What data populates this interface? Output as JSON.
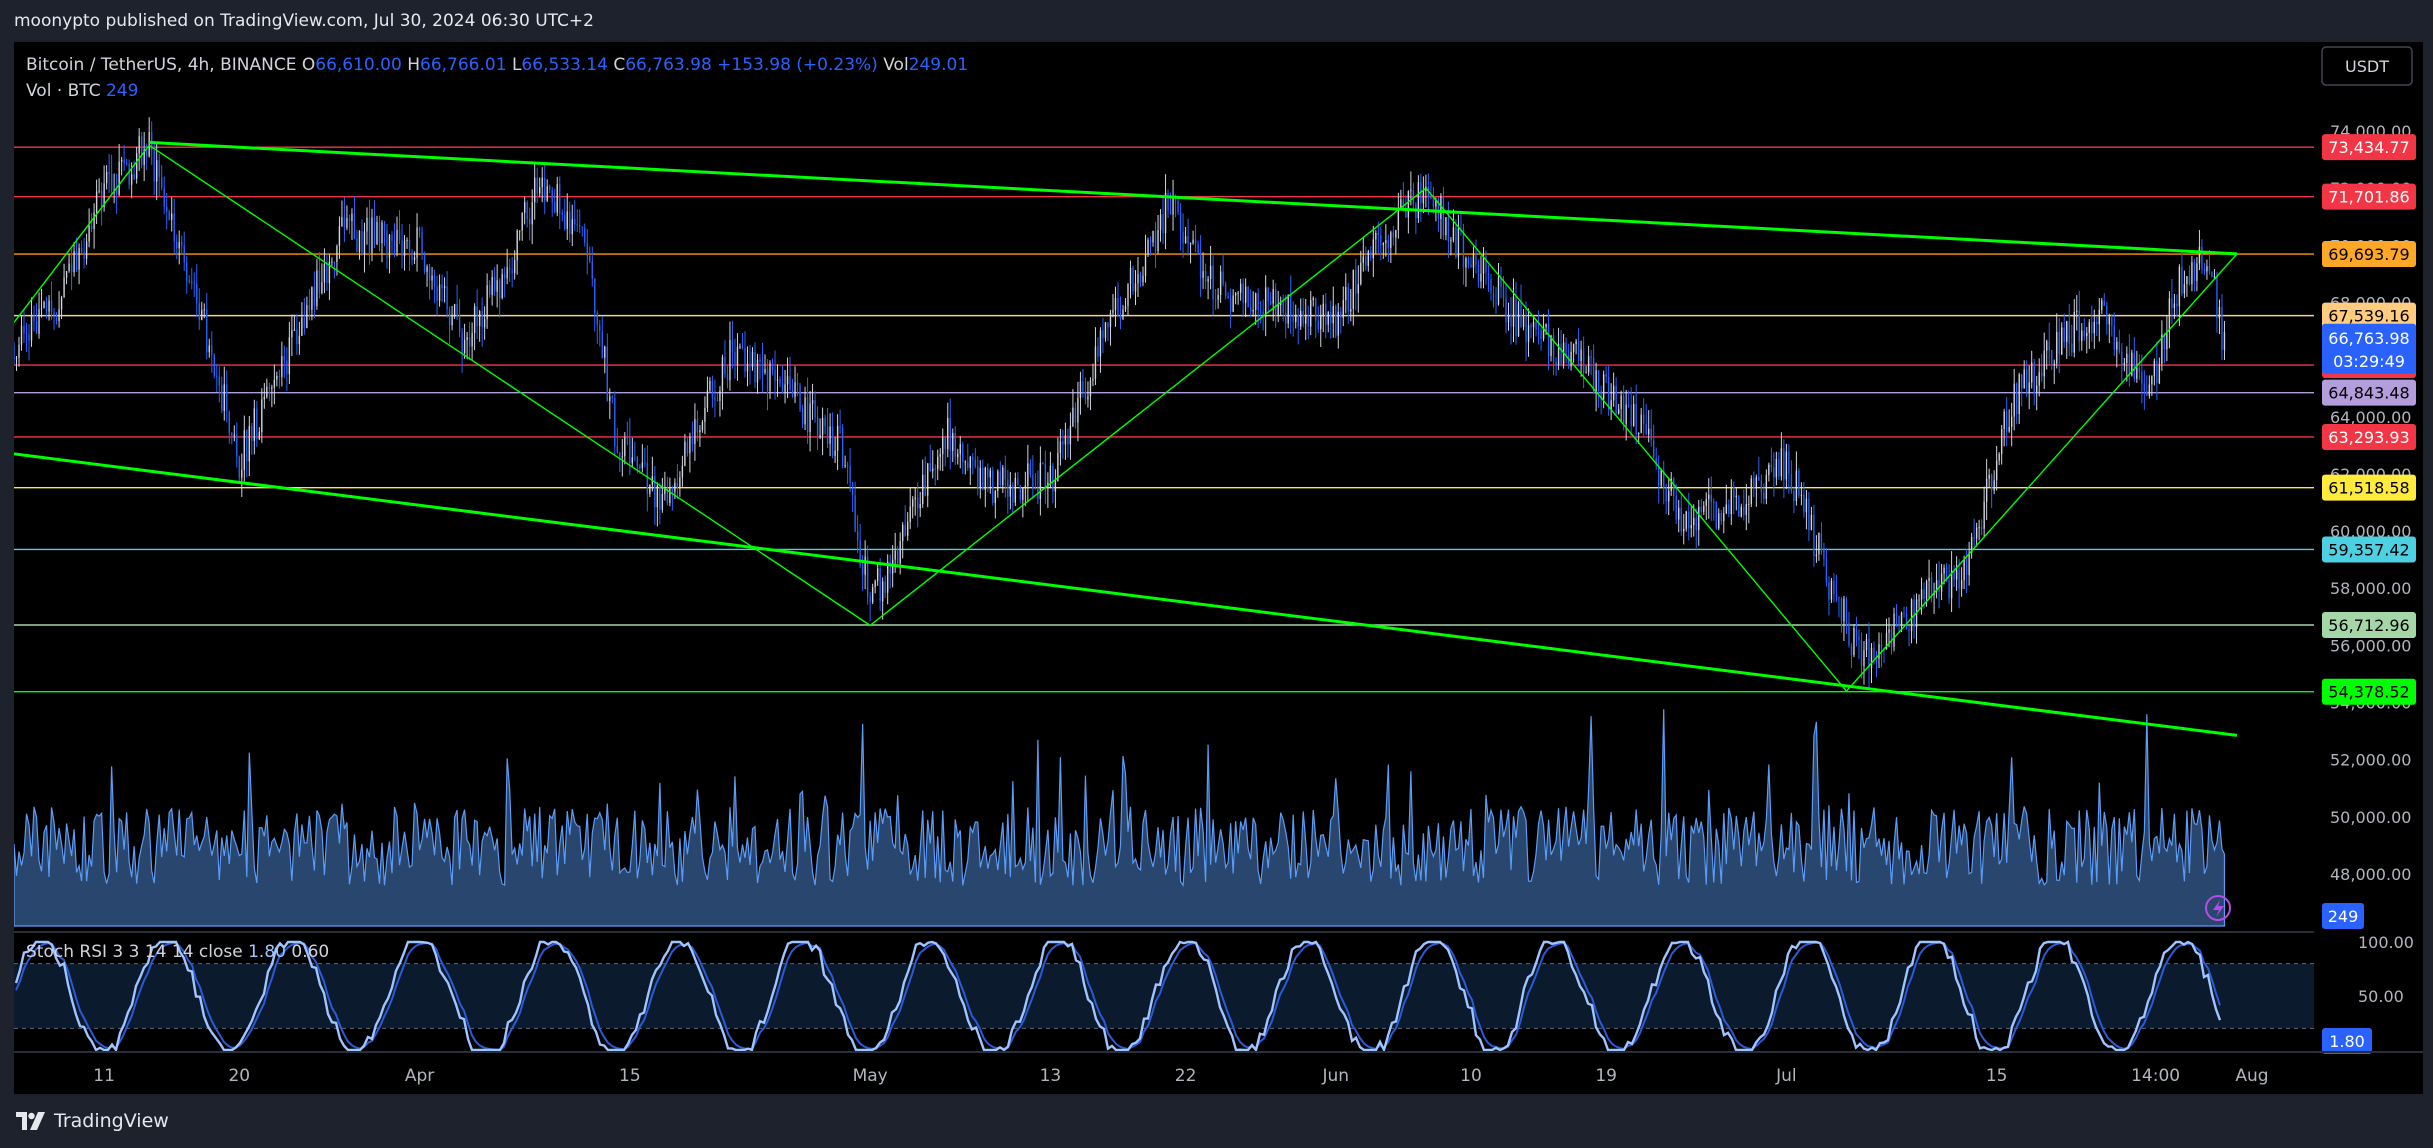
{
  "publish_note": "moonypto published on TradingView.com, Jul 30, 2024 06:30 UTC+2",
  "brand": "TradingView",
  "legend": {
    "symbol": "Bitcoin / TetherUS, 4h, BINANCE",
    "o_label": "O",
    "o_value": "66,610.00",
    "h_label": "H",
    "h_value": "66,766.01",
    "l_label": "L",
    "l_value": "66,533.14",
    "c_label": "C",
    "c_value": "66,763.98",
    "change": "+153.98 (+0.23%)",
    "vol_label": "Vol",
    "vol_value": "249.01",
    "vol_row_label": "Vol · BTC",
    "vol_row_value": "249",
    "stoch_label": "Stoch RSI 3 3 14 14 close",
    "stoch_k": "1.80",
    "stoch_d": "0.60"
  },
  "currency_button": "USDT",
  "colors": {
    "up": "#d1d4dc",
    "down": "#2962ff",
    "trend_green": "#00ff00",
    "volume": "#5b9cf6",
    "stoch_k": "#9fc5ff",
    "stoch_d": "#2a5bd7"
  },
  "chart_data": {
    "type": "candlestick",
    "symbol": "Bitcoin / TetherUS",
    "interval": "4h",
    "exchange": "BINANCE",
    "y_axis": {
      "range": [
        46500,
        75500
      ],
      "ticks": [
        {
          "v": 74000,
          "t": "74,000.00"
        },
        {
          "v": 72000,
          "t": "72,000.00"
        },
        {
          "v": 70000,
          "t": "70,000.00"
        },
        {
          "v": 68000,
          "t": "68,000.00"
        },
        {
          "v": 66000,
          "t": "66,000.00"
        },
        {
          "v": 64000,
          "t": "64,000.00"
        },
        {
          "v": 62000,
          "t": "62,000.00"
        },
        {
          "v": 60000,
          "t": "60,000.00"
        },
        {
          "v": 58000,
          "t": "58,000.00"
        },
        {
          "v": 56000,
          "t": "56,000.00"
        },
        {
          "v": 54000,
          "t": "54,000.00"
        },
        {
          "v": 52000,
          "t": "52,000.00"
        },
        {
          "v": 50000,
          "t": "50,000.00"
        },
        {
          "v": 48000,
          "t": "48,000.00"
        }
      ]
    },
    "x_axis": {
      "ticks": [
        {
          "d": "2024-03-11",
          "t": "11"
        },
        {
          "d": "2024-03-20",
          "t": "20"
        },
        {
          "d": "2024-04-01",
          "t": "Apr"
        },
        {
          "d": "2024-04-15",
          "t": "15"
        },
        {
          "d": "2024-05-01",
          "t": "May"
        },
        {
          "d": "2024-05-13",
          "t": "13"
        },
        {
          "d": "2024-05-22",
          "t": "22"
        },
        {
          "d": "2024-06-01",
          "t": "Jun"
        },
        {
          "d": "2024-06-10",
          "t": "10"
        },
        {
          "d": "2024-06-19",
          "t": "19"
        },
        {
          "d": "2024-07-01",
          "t": "Jul"
        },
        {
          "d": "2024-07-15",
          "t": "15"
        },
        {
          "d": "2024-07-25T14:00",
          "t": "14:00"
        },
        {
          "d": "2024-08-01",
          "t": "Aug"
        }
      ]
    },
    "price_path": [
      {
        "d": "2024-03-05",
        "p": 66500
      },
      {
        "d": "2024-03-08",
        "p": 68000
      },
      {
        "d": "2024-03-11",
        "p": 72000
      },
      {
        "d": "2024-03-14",
        "p": 73434
      },
      {
        "d": "2024-03-17",
        "p": 68500
      },
      {
        "d": "2024-03-20",
        "p": 62500
      },
      {
        "d": "2024-03-23",
        "p": 66000
      },
      {
        "d": "2024-03-27",
        "p": 70500
      },
      {
        "d": "2024-04-01",
        "p": 70000
      },
      {
        "d": "2024-04-04",
        "p": 66500
      },
      {
        "d": "2024-04-07",
        "p": 69500
      },
      {
        "d": "2024-04-09",
        "p": 72200
      },
      {
        "d": "2024-04-12",
        "p": 70500
      },
      {
        "d": "2024-04-14",
        "p": 63500
      },
      {
        "d": "2024-04-17",
        "p": 61000
      },
      {
        "d": "2024-04-19",
        "p": 63000
      },
      {
        "d": "2024-04-22",
        "p": 66500
      },
      {
        "d": "2024-04-26",
        "p": 64500
      },
      {
        "d": "2024-04-29",
        "p": 63000
      },
      {
        "d": "2024-05-01",
        "p": 57500
      },
      {
        "d": "2024-05-03",
        "p": 59500
      },
      {
        "d": "2024-05-06",
        "p": 63500
      },
      {
        "d": "2024-05-09",
        "p": 61500
      },
      {
        "d": "2024-05-13",
        "p": 61800
      },
      {
        "d": "2024-05-16",
        "p": 66000
      },
      {
        "d": "2024-05-21",
        "p": 71500
      },
      {
        "d": "2024-05-24",
        "p": 68500
      },
      {
        "d": "2024-05-28",
        "p": 68000
      },
      {
        "d": "2024-06-01",
        "p": 67500
      },
      {
        "d": "2024-06-05",
        "p": 71000
      },
      {
        "d": "2024-06-07",
        "p": 71800
      },
      {
        "d": "2024-06-10",
        "p": 69500
      },
      {
        "d": "2024-06-13",
        "p": 67500
      },
      {
        "d": "2024-06-17",
        "p": 66000
      },
      {
        "d": "2024-06-21",
        "p": 64000
      },
      {
        "d": "2024-06-24",
        "p": 60500
      },
      {
        "d": "2024-06-28",
        "p": 61000
      },
      {
        "d": "2024-07-01",
        "p": 62500
      },
      {
        "d": "2024-07-04",
        "p": 58000
      },
      {
        "d": "2024-07-06",
        "p": 55500
      },
      {
        "d": "2024-07-08",
        "p": 56500
      },
      {
        "d": "2024-07-11",
        "p": 58000
      },
      {
        "d": "2024-07-13",
        "p": 58500
      },
      {
        "d": "2024-07-16",
        "p": 64500
      },
      {
        "d": "2024-07-19",
        "p": 66500
      },
      {
        "d": "2024-07-22",
        "p": 67800
      },
      {
        "d": "2024-07-25",
        "p": 64500
      },
      {
        "d": "2024-07-27",
        "p": 68500
      },
      {
        "d": "2024-07-29",
        "p": 69800
      },
      {
        "d": "2024-07-30",
        "p": 66764
      }
    ],
    "horizontal_levels": [
      {
        "value": 73434.77,
        "label": "73,434.77",
        "line": "#f23645",
        "badge": "#f23645",
        "text": "#ffffff"
      },
      {
        "value": 71701.86,
        "label": "71,701.86",
        "line": "#f23645",
        "badge": "#f23645",
        "text": "#ffffff"
      },
      {
        "value": 69693.79,
        "label": "69,693.79",
        "line": "#ff9800",
        "badge": "#ffa726",
        "text": "#000000"
      },
      {
        "value": 67539.16,
        "label": "67,539.16",
        "line": "#ffcc80",
        "badge": "#ffcc80",
        "text": "#000000"
      },
      {
        "value": 65810.44,
        "label": "65,810.44",
        "line": "#f23645",
        "badge": "#f23645",
        "text": "#ffffff"
      },
      {
        "value": 64843.48,
        "label": "64,843.48",
        "line": "#b39ddb",
        "badge": "#b39ddb",
        "text": "#000000"
      },
      {
        "value": 63293.93,
        "label": "63,293.93",
        "line": "#f23645",
        "badge": "#f23645",
        "text": "#ffffff"
      },
      {
        "value": 61518.58,
        "label": "61,518.58",
        "line": "#ffeb3b",
        "badge": "#ffeb3b",
        "text": "#000000"
      },
      {
        "value": 59357.42,
        "label": "59,357.42",
        "line": "#4dd0e1",
        "badge": "#4dd0e1",
        "text": "#000000"
      },
      {
        "value": 56712.96,
        "label": "56,712.96",
        "line": "#a5d6a7",
        "badge": "#a5d6a7",
        "text": "#000000"
      },
      {
        "value": 54378.52,
        "label": "54,378.52",
        "line": "#00ff00",
        "badge": "#00ff00",
        "text": "#000000"
      }
    ],
    "current_price": {
      "value": 66763.98,
      "label": "66,763.98",
      "countdown": "03:29:49",
      "badge": "#2962ff"
    },
    "trendlines_bold": [
      {
        "from": {
          "d": "2024-03-14",
          "p": 73600
        },
        "to": {
          "d": "2024-07-31",
          "p": 69700
        }
      },
      {
        "from": {
          "d": "2024-03-05",
          "p": 62700
        },
        "to": {
          "d": "2024-07-31",
          "p": 52850
        }
      }
    ],
    "trendlines_thin": [
      {
        "from": {
          "d": "2024-03-05",
          "p": 67300
        },
        "to": {
          "d": "2024-03-14",
          "p": 73500
        }
      },
      {
        "from": {
          "d": "2024-03-14",
          "p": 73500
        },
        "to": {
          "d": "2024-05-01",
          "p": 56700
        }
      },
      {
        "from": {
          "d": "2024-05-01",
          "p": 56700
        },
        "to": {
          "d": "2024-06-07",
          "p": 72000
        }
      },
      {
        "from": {
          "d": "2024-06-07",
          "p": 72000
        },
        "to": {
          "d": "2024-07-05",
          "p": 54400
        }
      },
      {
        "from": {
          "d": "2024-07-05",
          "p": 54400
        },
        "to": {
          "d": "2024-07-31",
          "p": 69700
        }
      }
    ],
    "volume_pane": {
      "label": "Vol · BTC",
      "last": "249",
      "last_badge": "249"
    },
    "stoch_pane": {
      "levels": [
        {
          "v": 100,
          "t": "100.00"
        },
        {
          "v": 50,
          "t": "50.00"
        }
      ],
      "band": [
        20,
        80
      ],
      "last_badge": "1.80"
    }
  }
}
